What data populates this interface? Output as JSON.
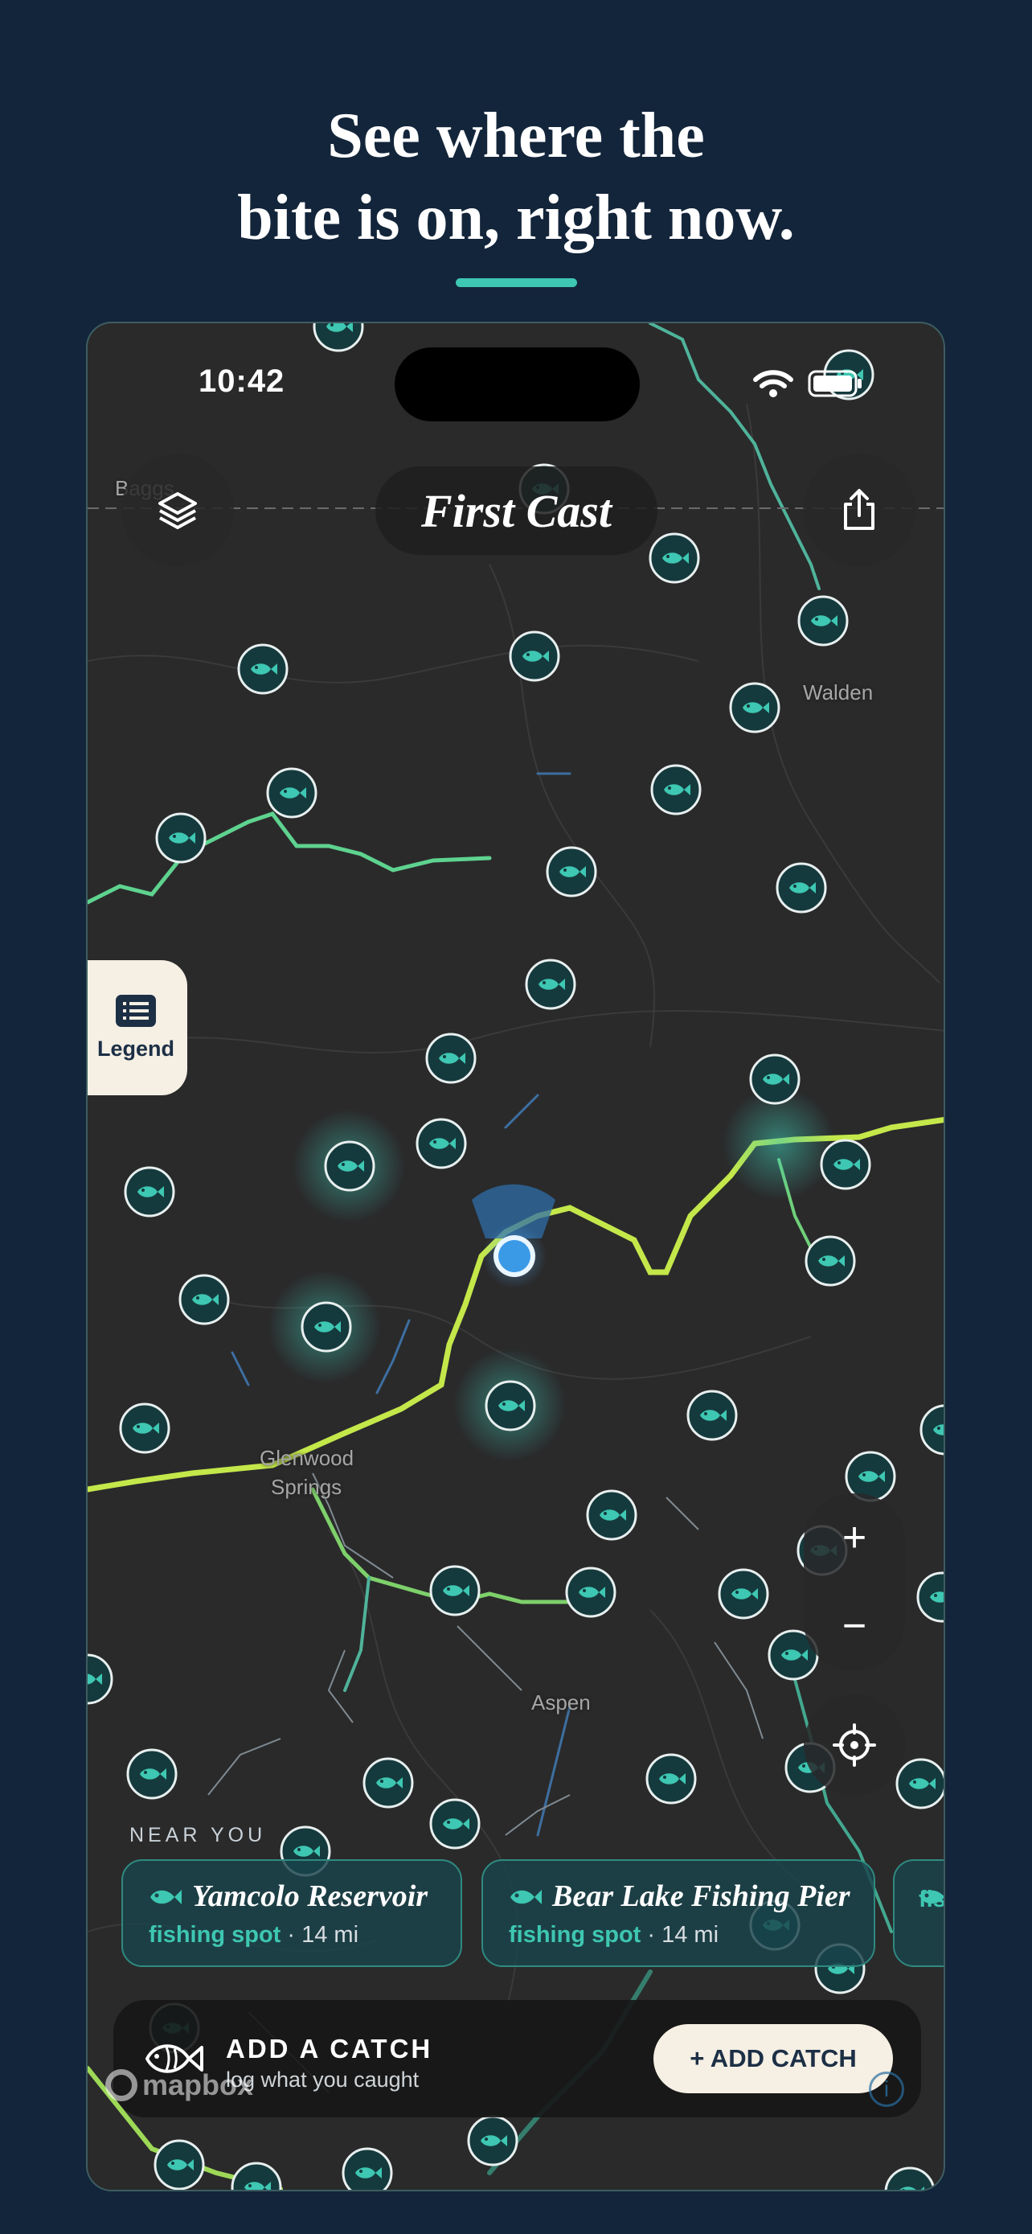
{
  "promo": {
    "headline_line1": "See where the",
    "headline_line2": "bite is on, right now."
  },
  "status_bar": {
    "time": "10:42"
  },
  "header": {
    "app_title": "First Cast"
  },
  "map": {
    "place_labels": [
      "Baggs",
      "Walden",
      "Glenwood",
      "Springs",
      "Aspen"
    ],
    "legend_label": "Legend",
    "zoom_in": "+",
    "zoom_out": "−"
  },
  "near_you": {
    "label": "NEAR YOU",
    "spots": [
      {
        "name": "Yamcolo Reservoir",
        "type": "fishing spot",
        "distance": "· 14 mi"
      },
      {
        "name": "Bear Lake Fishing Pier",
        "type": "fishing spot",
        "distance": "· 14 mi"
      },
      {
        "name": "",
        "type": "fis",
        "distance": ""
      }
    ]
  },
  "add_catch": {
    "title": "ADD A CATCH",
    "subtitle": "log what you caught",
    "button_label": "+ ADD CATCH"
  },
  "attribution": {
    "logo_text": "mapbox",
    "info_glyph": "i"
  },
  "colors": {
    "background": "#13253a",
    "accent": "#3ec7b2",
    "map": "#2a2a2b",
    "river_bright": "#c4e84a",
    "cream": "#f5efe4"
  }
}
